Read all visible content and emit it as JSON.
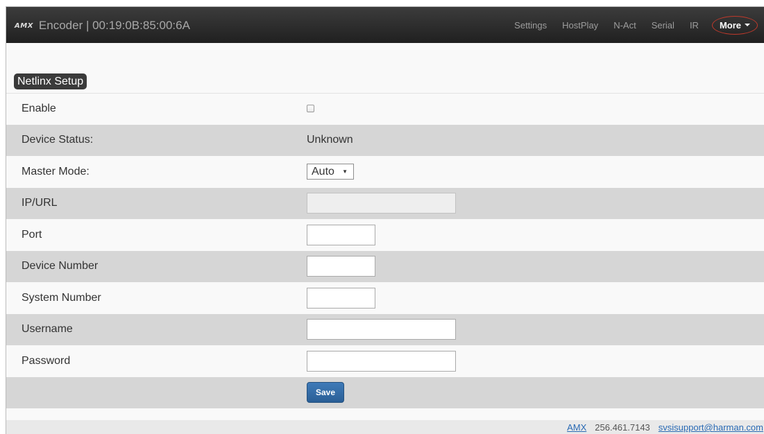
{
  "brand": {
    "logo": "AMX",
    "title": "Encoder | 00:19:0B:85:00:6A"
  },
  "nav": {
    "links": [
      "Settings",
      "HostPlay",
      "N-Act",
      "Serial",
      "IR"
    ],
    "more_label": "More"
  },
  "section": {
    "title": "Netlinx Setup"
  },
  "form": {
    "enable_label": "Enable",
    "device_status_label": "Device Status:",
    "device_status_value": "Unknown",
    "master_mode_label": "Master Mode:",
    "master_mode_value": "Auto",
    "ip_url_label": "IP/URL",
    "port_label": "Port",
    "device_number_label": "Device Number",
    "system_number_label": "System Number",
    "username_label": "Username",
    "password_label": "Password",
    "save_label": "Save"
  },
  "footer": {
    "amx_link": "AMX",
    "phone": "256.461.7143",
    "email": "svsisupport@harman.com"
  }
}
